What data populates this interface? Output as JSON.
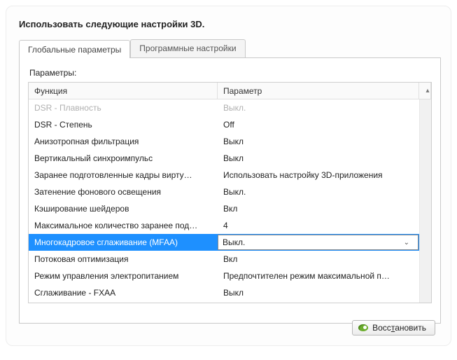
{
  "panel": {
    "title": "Использовать следующие настройки 3D."
  },
  "tabs": {
    "global": "Глобальные параметры",
    "program": "Программные настройки"
  },
  "params_label": "Параметры:",
  "grid": {
    "header_func": "Функция",
    "header_val": "Параметр",
    "rows": [
      {
        "func": "DSR - Плавность",
        "val": "Выкл.",
        "state": "disabled"
      },
      {
        "func": "DSR - Степень",
        "val": "Off",
        "state": ""
      },
      {
        "func": "Анизотропная фильтрация",
        "val": "Выкл",
        "state": ""
      },
      {
        "func": "Вертикальный синхроимпульс",
        "val": "Выкл",
        "state": ""
      },
      {
        "func": "Заранее подготовленные кадры вирту…",
        "val": "Использовать настройку 3D-приложения",
        "state": ""
      },
      {
        "func": "Затенение фонового освещения",
        "val": "Выкл.",
        "state": ""
      },
      {
        "func": "Кэширование шейдеров",
        "val": "Вкл",
        "state": ""
      },
      {
        "func": "Максимальное количество заранее под…",
        "val": "4",
        "state": ""
      },
      {
        "func": "Многокадровое сглаживание (MFAA)",
        "val": "Выкл.",
        "state": "selected"
      },
      {
        "func": "Потоковая оптимизация",
        "val": "Вкл",
        "state": ""
      },
      {
        "func": "Режим управления электропитанием",
        "val": "Предпочтителен режим максимальной п…",
        "state": ""
      },
      {
        "func": "Сглаживание - FXAA",
        "val": "Выкл",
        "state": ""
      }
    ]
  },
  "footer": {
    "restore_pre": "Восс",
    "restore_u": "т",
    "restore_post": "ановить"
  }
}
